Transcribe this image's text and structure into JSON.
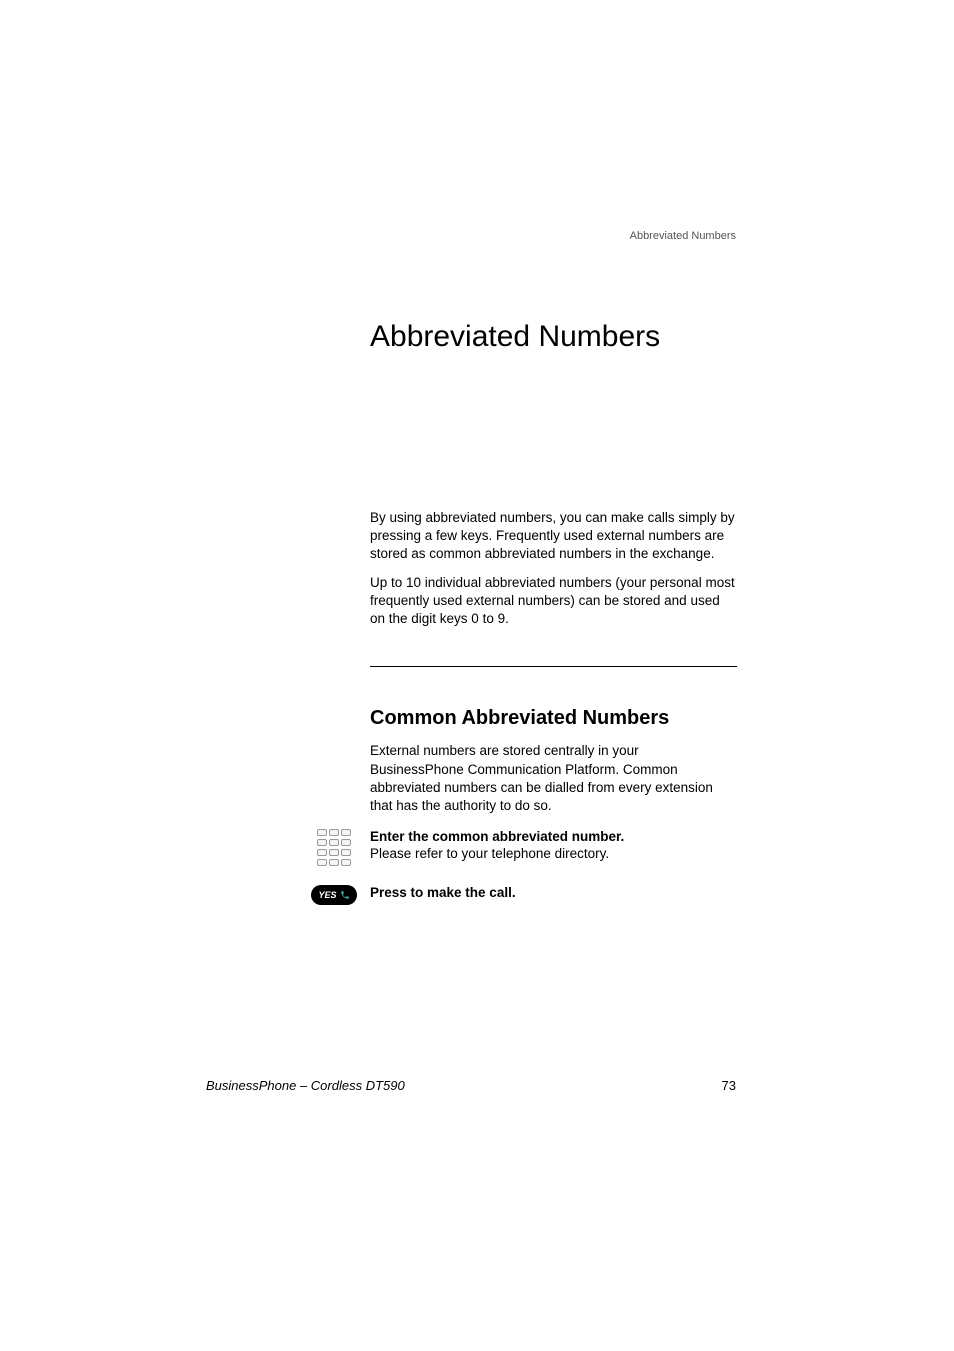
{
  "header": {
    "running_title": "Abbreviated Numbers"
  },
  "title": "Abbreviated Numbers",
  "intro": {
    "p1": "By using abbreviated numbers, you can make calls simply by pressing a few keys. Frequently used external numbers are stored as common abbreviated numbers in the exchange.",
    "p2": "Up to 10 individual abbreviated numbers (your personal most frequently used external numbers) can be stored and used on the digit keys 0 to 9."
  },
  "section": {
    "title": "Common Abbreviated Numbers",
    "p1": "External numbers are stored centrally in your BusinessPhone Communication Platform. Common abbreviated numbers can be dialled from every extension that has the authority to do so.",
    "step1_bold": "Enter the common abbreviated number.",
    "step1_sub": "Please refer to your telephone directory.",
    "step2_bold": "Press to make the call.",
    "yes_label": "YES"
  },
  "footer": {
    "left": "BusinessPhone – Cordless DT590",
    "page": "73"
  }
}
